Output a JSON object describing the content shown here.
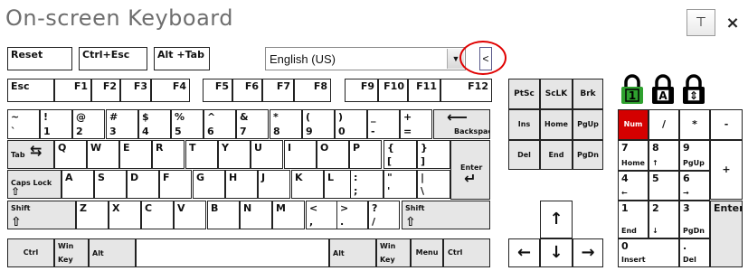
{
  "title": "On-screen Keyboard",
  "window_buttons": {
    "pin": "⊤",
    "close": "×"
  },
  "toolbar": {
    "reset": "Reset",
    "ctrl_esc": "Ctrl+Esc",
    "alt_tab": "Alt +Tab",
    "language": "English (US)",
    "collapse": "<"
  },
  "fn_row": [
    "Esc",
    "F1",
    "F2",
    "F3",
    "F4",
    "F5",
    "F6",
    "F7",
    "F8",
    "F9",
    "F10",
    "F11",
    "F12"
  ],
  "num_row": [
    {
      "top": "~",
      "bottom": "`"
    },
    {
      "top": "!",
      "bottom": "1"
    },
    {
      "top": "@",
      "bottom": "2"
    },
    {
      "top": "#",
      "bottom": "3"
    },
    {
      "top": "$",
      "bottom": "4"
    },
    {
      "top": "%",
      "bottom": "5"
    },
    {
      "top": "^",
      "bottom": "6"
    },
    {
      "top": "&",
      "bottom": "7"
    },
    {
      "top": "*",
      "bottom": "8"
    },
    {
      "top": "(",
      "bottom": "9"
    },
    {
      "top": ")",
      "bottom": "0"
    },
    {
      "top": "_",
      "bottom": "-"
    },
    {
      "top": "+",
      "bottom": "="
    }
  ],
  "backspace": "Backspace",
  "tab": "Tab",
  "q_row": [
    "Q",
    "W",
    "E",
    "R",
    "T",
    "Y",
    "U",
    "I",
    "O",
    "P"
  ],
  "q_row_sym": [
    {
      "top": "{",
      "bottom": "["
    },
    {
      "top": "}",
      "bottom": "]"
    }
  ],
  "enter": "Enter",
  "caps_lock": "Caps Lock",
  "a_row": [
    "A",
    "S",
    "D",
    "F",
    "G",
    "H",
    "J",
    "K",
    "L"
  ],
  "a_row_sym": [
    {
      "top": ":",
      "bottom": ";"
    },
    {
      "top": "\"",
      "bottom": "'"
    },
    {
      "top": "|",
      "bottom": "\\"
    }
  ],
  "shift": "Shift",
  "z_row": [
    "Z",
    "X",
    "C",
    "V",
    "B",
    "N",
    "M"
  ],
  "z_row_sym": [
    {
      "top": "<",
      "bottom": ","
    },
    {
      "top": ">",
      "bottom": "."
    },
    {
      "top": "?",
      "bottom": "/"
    }
  ],
  "bottom_row": {
    "ctrl": "Ctrl",
    "win_top": "Win",
    "win_bottom": "Key",
    "alt": "Alt",
    "menu": "Menu"
  },
  "nav": {
    "psc": "PtSc",
    "sclk": "ScLK",
    "brk": "Brk",
    "ins": "Ins",
    "home": "Home",
    "pgup": "PgUp",
    "del": "Del",
    "end": "End",
    "pgdn": "PgDn"
  },
  "locks": {
    "num_lock": "1",
    "caps_lock": "A",
    "scroll_lock": "⇕"
  },
  "numpad": {
    "num": "Num",
    "slash": "/",
    "star": "*",
    "minus": "-",
    "plus": "+",
    "enter": "Enter",
    "k7": "7",
    "k7b": "Home",
    "k8": "8",
    "k8b": "↑",
    "k9": "9",
    "k9b": "PgUp",
    "k4": "4",
    "k4b": "←",
    "k5": "5",
    "k6": "6",
    "k6b": "→",
    "k1": "1",
    "k1b": "End",
    "k2": "2",
    "k2b": "↓",
    "k3": "3",
    "k3b": "PgDn",
    "k0": "0",
    "k0b": "Insert",
    "dot": ".",
    "dotb": "Del"
  },
  "arrows": {
    "up": "↑",
    "down": "↓",
    "left": "←",
    "right": "→"
  },
  "colors": {
    "num_active": "#d40000",
    "lock_green": "#2fa12f",
    "highlight_ring": "#e00000"
  }
}
